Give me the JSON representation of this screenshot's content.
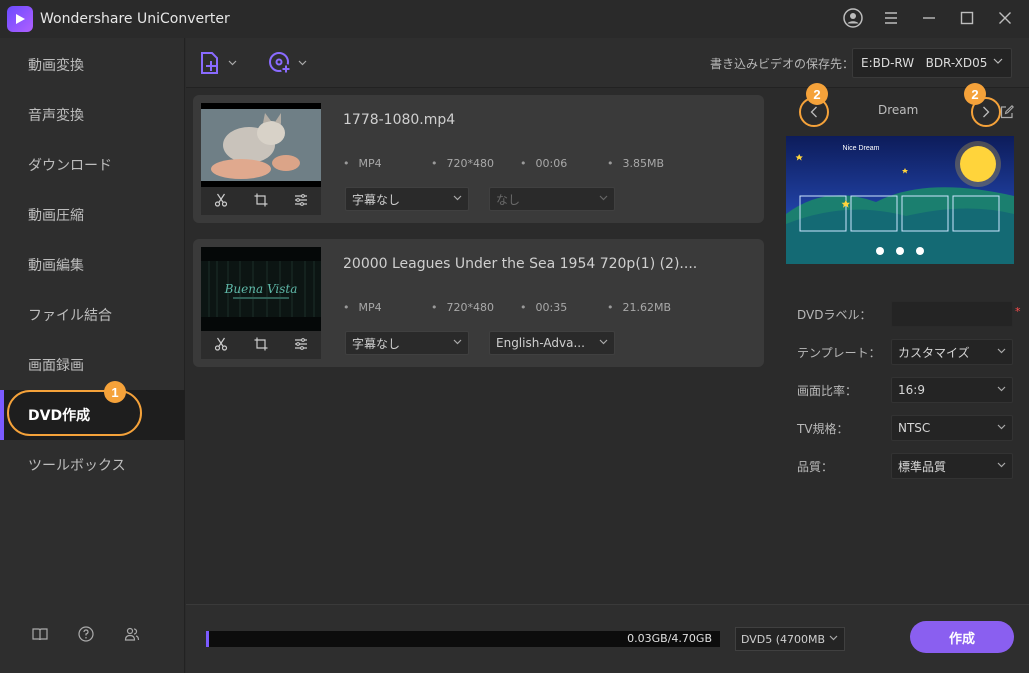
{
  "app": {
    "title": "Wondershare UniConverter"
  },
  "sidebar": {
    "items": [
      {
        "label": "動画変換"
      },
      {
        "label": "音声変換"
      },
      {
        "label": "ダウンロード"
      },
      {
        "label": "動画圧縮"
      },
      {
        "label": "動画編集"
      },
      {
        "label": "ファイル結合"
      },
      {
        "label": "画面録画"
      },
      {
        "label": "DVD作成"
      },
      {
        "label": "ツールボックス"
      }
    ],
    "active_index": 7,
    "annotation_badge": "1"
  },
  "toolbar": {
    "destination_label": "書き込みビデオの保存先：",
    "destination_value": "E:BD-RW   BDR-XD05"
  },
  "files": [
    {
      "name": "1778-1080.mp4",
      "format": "MP4",
      "resolution": "720*480",
      "duration": "00:06",
      "size": "3.85MB",
      "subtitle": "字幕なし",
      "audio": "なし"
    },
    {
      "name": "20000 Leagues Under the Sea 1954 720p(1) (2)....",
      "format": "MP4",
      "resolution": "720*480",
      "duration": "00:35",
      "size": "21.62MB",
      "subtitle": "字幕なし",
      "audio": "English-Adva...",
      "thumb_text": "Buena Vista"
    }
  ],
  "template": {
    "name": "Dream",
    "preview_title": "Nice Dream",
    "annotation_badge": "2"
  },
  "options": {
    "dvd_label": {
      "label": "DVDラベル：",
      "value": ""
    },
    "template": {
      "label": "テンプレート：",
      "value": "カスタマイズ"
    },
    "aspect": {
      "label": "画面比率：",
      "value": "16:9"
    },
    "tv_standard": {
      "label": "TV規格：",
      "value": "NTSC"
    },
    "quality": {
      "label": "品質：",
      "value": "標準品質"
    }
  },
  "bottom": {
    "usage_text": "0.03GB/4.70GB",
    "usage_fraction": 0.0064,
    "disc_type": "DVD5 (4700MB",
    "create_label": "作成"
  },
  "colors": {
    "accent": "#7b5bff",
    "annotation": "#f5a23a",
    "create_button": "#8a5ff0"
  }
}
